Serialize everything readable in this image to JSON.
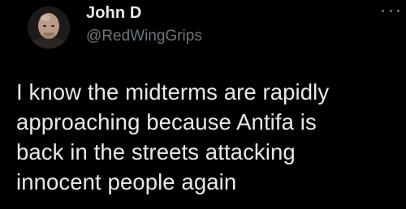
{
  "author": {
    "display_name": "John D",
    "handle": "@RedWingGrips",
    "avatar_icon": "bald-man-avatar"
  },
  "menu": {
    "icon": "more-options-icon"
  },
  "tweet": {
    "text": "I know the midterms are rapidly\napproaching because Antifa is\nback in the streets attacking\ninnocent people again"
  },
  "colors": {
    "background": "#000000",
    "primary_text": "#e7e9ea",
    "secondary_text": "#71767b"
  }
}
